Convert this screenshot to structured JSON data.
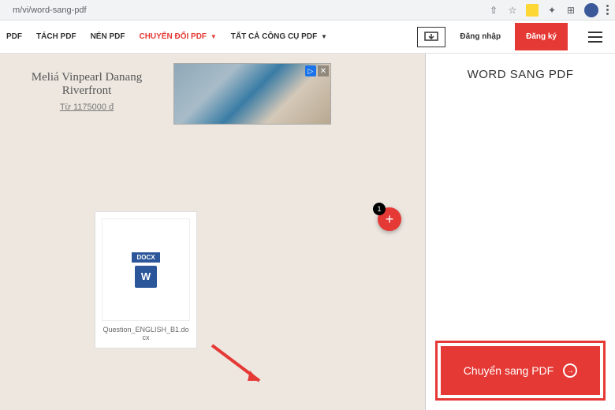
{
  "browser": {
    "url": "m/vi/word-sang-pdf"
  },
  "nav": {
    "items": [
      {
        "label": "PDF",
        "red": false,
        "dropdown": false
      },
      {
        "label": "TÁCH PDF",
        "red": false,
        "dropdown": false
      },
      {
        "label": "NÉN PDF",
        "red": false,
        "dropdown": false
      },
      {
        "label": "CHUYỂN ĐỔI PDF",
        "red": true,
        "dropdown": true
      },
      {
        "label": "TẤT CẢ CÔNG CỤ PDF",
        "red": false,
        "dropdown": true
      }
    ],
    "login": "Đăng nhập",
    "signup": "Đăng ký"
  },
  "ad": {
    "title": "Meliá Vinpearl Danang Riverfront",
    "price": "Từ 1175000 đ"
  },
  "file": {
    "badge": "DOCX",
    "icon_letter": "W",
    "name": "Question_ENGLISH_B1.docx"
  },
  "add_button": {
    "count": "1",
    "plus": "+"
  },
  "right": {
    "title": "WORD SANG PDF",
    "convert_label": "Chuyển sang PDF"
  }
}
